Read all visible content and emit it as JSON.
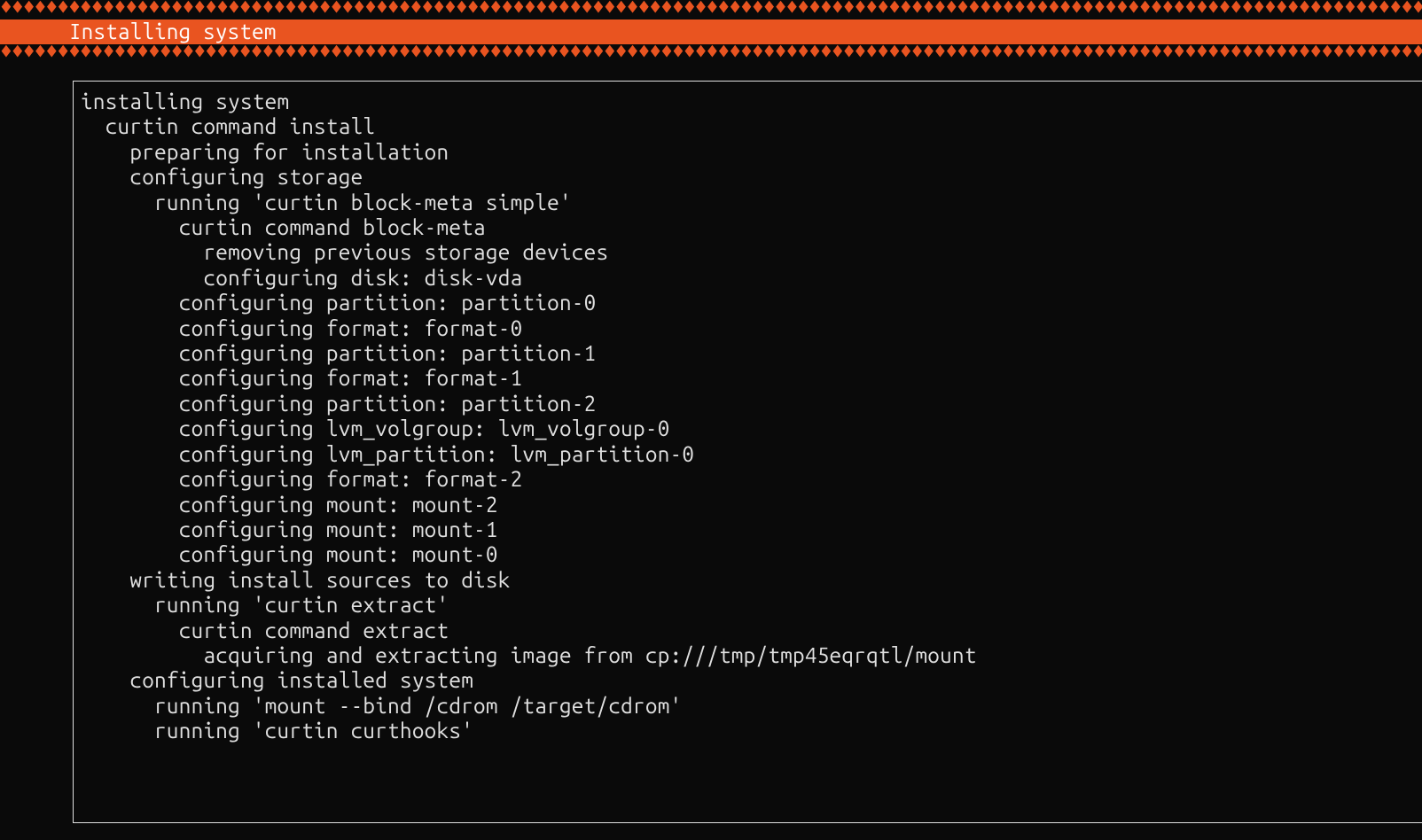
{
  "header": {
    "pattern": "♦♦♦♦♦♦♦♦♦♦♦♦♦♦♦♦♦♦♦♦♦♦♦♦♦♦♦♦♦♦♦♦♦♦♦♦♦♦♦♦♦♦♦♦♦♦♦♦♦♦♦♦♦♦♦♦♦♦♦♦♦♦♦♦♦♦♦♦♦♦♦♦♦♦♦♦♦♦♦♦♦♦♦♦♦♦♦♦♦♦♦♦♦♦♦♦♦♦♦♦♦♦♦♦♦♦♦♦♦♦♦♦♦♦♦♦♦♦♦♦♦♦♦♦♦♦♦♦♦♦♦♦♦♦♦♦♦♦♦♦♦♦♦♦♦♦♦♦♦♦♦♦♦♦♦♦♦♦♦♦♦♦♦♦♦♦♦♦♦♦♦♦♦♦♦♦♦♦♦♦♦♦♦♦♦♦♦♦♦♦♦♦♦♦♦♦♦♦♦♦♦♦♦♦♦♦♦♦♦♦♦♦♦♦♦♦♦♦♦♦♦♦♦♦♦♦♦♦♦♦♦♦♦♦♦♦♦♦♦♦♦♦♦♦♦♦♦♦♦♦♦♦♦♦♦♦",
    "title": "Installing system"
  },
  "log": {
    "lines": [
      {
        "indent": 0,
        "text": "installing system"
      },
      {
        "indent": 1,
        "text": "curtin command install"
      },
      {
        "indent": 2,
        "text": "preparing for installation"
      },
      {
        "indent": 2,
        "text": "configuring storage"
      },
      {
        "indent": 3,
        "text": "running 'curtin block-meta simple'"
      },
      {
        "indent": 4,
        "text": "curtin command block-meta"
      },
      {
        "indent": 5,
        "text": "removing previous storage devices"
      },
      {
        "indent": 5,
        "text": "configuring disk: disk-vda"
      },
      {
        "indent": 4,
        "text": "configuring partition: partition-0"
      },
      {
        "indent": 4,
        "text": "configuring format: format-0"
      },
      {
        "indent": 4,
        "text": "configuring partition: partition-1"
      },
      {
        "indent": 4,
        "text": "configuring format: format-1"
      },
      {
        "indent": 4,
        "text": "configuring partition: partition-2"
      },
      {
        "indent": 4,
        "text": "configuring lvm_volgroup: lvm_volgroup-0"
      },
      {
        "indent": 4,
        "text": "configuring lvm_partition: lvm_partition-0"
      },
      {
        "indent": 4,
        "text": "configuring format: format-2"
      },
      {
        "indent": 4,
        "text": "configuring mount: mount-2"
      },
      {
        "indent": 4,
        "text": "configuring mount: mount-1"
      },
      {
        "indent": 4,
        "text": "configuring mount: mount-0"
      },
      {
        "indent": 2,
        "text": "writing install sources to disk"
      },
      {
        "indent": 3,
        "text": "running 'curtin extract'"
      },
      {
        "indent": 4,
        "text": "curtin command extract"
      },
      {
        "indent": 5,
        "text": "acquiring and extracting image from cp:///tmp/tmp45eqrqtl/mount"
      },
      {
        "indent": 2,
        "text": "configuring installed system"
      },
      {
        "indent": 3,
        "text": "running 'mount --bind /cdrom /target/cdrom'"
      },
      {
        "indent": 3,
        "text": "running 'curtin curthooks'"
      }
    ]
  }
}
